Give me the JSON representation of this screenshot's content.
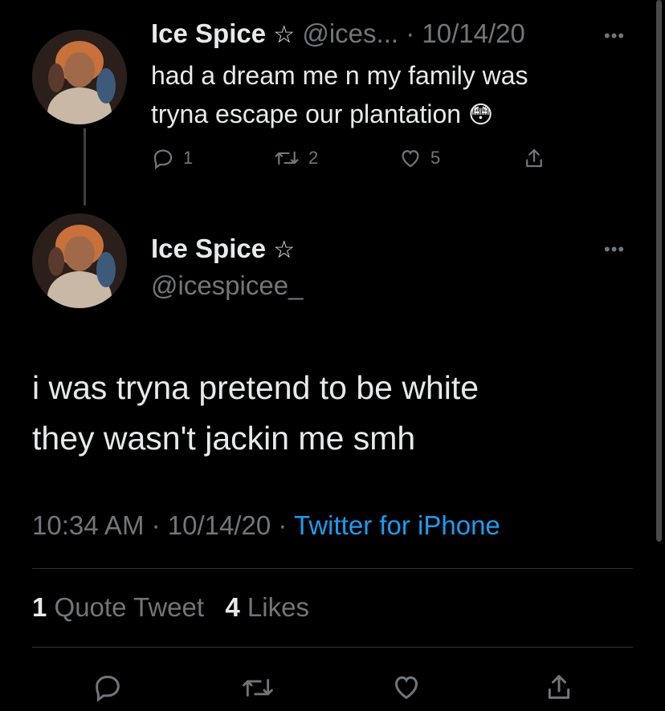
{
  "parent_tweet": {
    "display_name": "Ice Spice",
    "star": "☆",
    "handle": "@ices...",
    "separator": "·",
    "date": "10/14/20",
    "more": "•••",
    "text_line1": "had a dream me n my family was",
    "text_line2": "tryna escape our plantation",
    "emoji": "😳",
    "reply_count": "1",
    "retweet_count": "2",
    "like_count": "5"
  },
  "main_tweet": {
    "display_name": "Ice Spice",
    "star": "☆",
    "handle": "@icespicee_",
    "more": "•••",
    "text_line1": "i was tryna pretend to be white",
    "text_line2": "they wasn't jackin me smh",
    "time": "10:34 AM",
    "dot1": "·",
    "date": "10/14/20",
    "dot2": "·",
    "source": "Twitter for iPhone"
  },
  "stats": {
    "quote_count": "1",
    "quote_label": "Quote Tweet",
    "like_count": "4",
    "like_label": "Likes"
  },
  "colors": {
    "background": "#000000",
    "text": "#e7e9ea",
    "muted": "#71767b",
    "link": "#1d9bf0",
    "divider": "#2f3336"
  },
  "icons": [
    "reply-icon",
    "retweet-icon",
    "like-icon",
    "share-icon",
    "more-icon",
    "avatar"
  ]
}
